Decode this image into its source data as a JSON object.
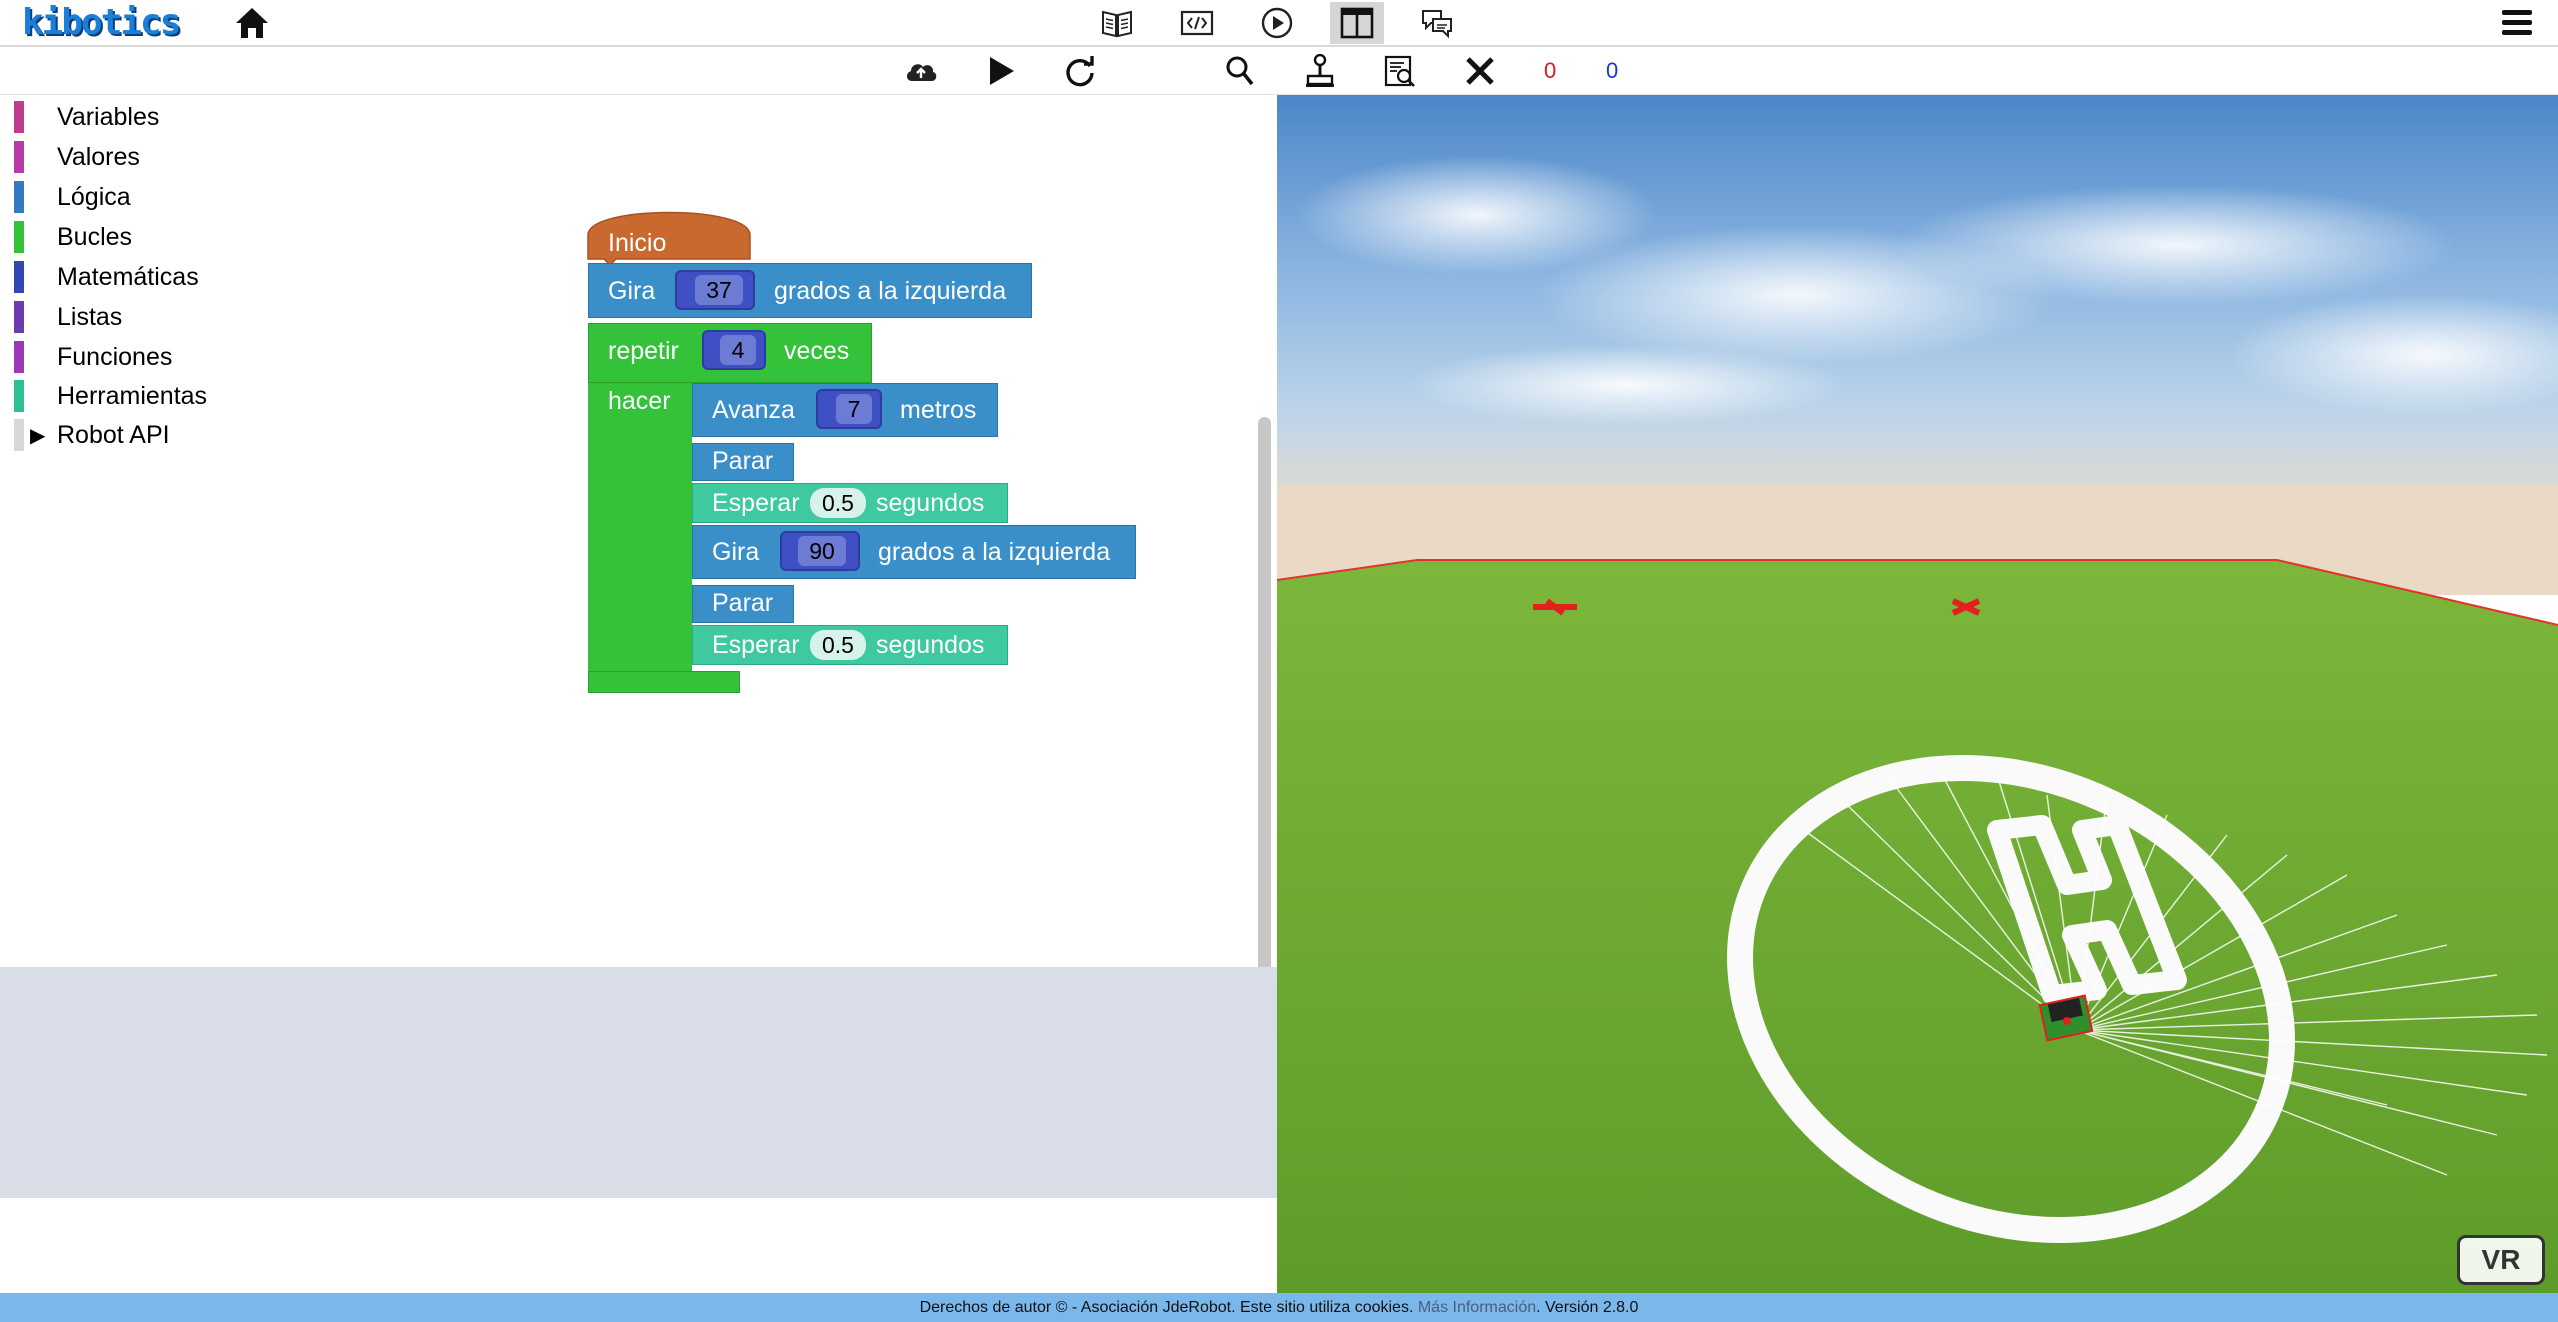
{
  "app": {
    "logo_text": "kibotics"
  },
  "nav": {
    "icons": [
      "home-icon",
      "book-icon",
      "code-icon",
      "play-circle-icon",
      "split-view-icon",
      "chat-icon",
      "hamburger-menu-icon"
    ],
    "active": "split-view-icon"
  },
  "toolbar": {
    "buttons": [
      "upload-icon",
      "play-icon",
      "reset-icon",
      "search-icon",
      "joystick-icon",
      "inspect-icon",
      "close-icon"
    ],
    "counter_red": "0",
    "counter_blue": "0"
  },
  "toolbox": {
    "categories": [
      {
        "label": "Variables",
        "color": "#c03c8c"
      },
      {
        "label": "Valores",
        "color": "#b83aa8"
      },
      {
        "label": "Lógica",
        "color": "#3778c2"
      },
      {
        "label": "Bucles",
        "color": "#33c23a"
      },
      {
        "label": "Matemáticas",
        "color": "#3246b4"
      },
      {
        "label": "Listas",
        "color": "#6a3cb0"
      },
      {
        "label": "Funciones",
        "color": "#9a3ab8"
      },
      {
        "label": "Herramientas",
        "color": "#2fbf93"
      },
      {
        "label": "Robot API",
        "color": "#d8d8d8"
      }
    ]
  },
  "program": {
    "start_label": "Inicio",
    "turn1": {
      "label": "Gira",
      "value": "37",
      "suffix": "grados a la izquierda"
    },
    "loop": {
      "label": "repetir",
      "value": "4",
      "suffix": "veces",
      "do_label": "hacer"
    },
    "forward": {
      "label": "Avanza",
      "value": "7",
      "suffix": "metros"
    },
    "stop1": "Parar",
    "wait1": {
      "label": "Esperar",
      "value": "0.5",
      "suffix": "segundos"
    },
    "turn2": {
      "label": "Gira",
      "value": "90",
      "suffix": "grados a la izquierda"
    },
    "stop2": "Parar",
    "wait2": {
      "label": "Esperar",
      "value": "0.5",
      "suffix": "segundos"
    }
  },
  "scene": {
    "vr_label": "VR"
  },
  "footer": {
    "text": "Derechos de autor © - Asociación JdeRobot. Este sitio utiliza cookies.",
    "link": "Más Información",
    "version": ". Versión 2.8.0"
  },
  "colors": {
    "start_block": "#c9692f",
    "robot_block": "#3a8fc9",
    "loop_block": "#33c23a",
    "wait_block": "#3ec9a0",
    "footer": "#7ab8ec"
  }
}
